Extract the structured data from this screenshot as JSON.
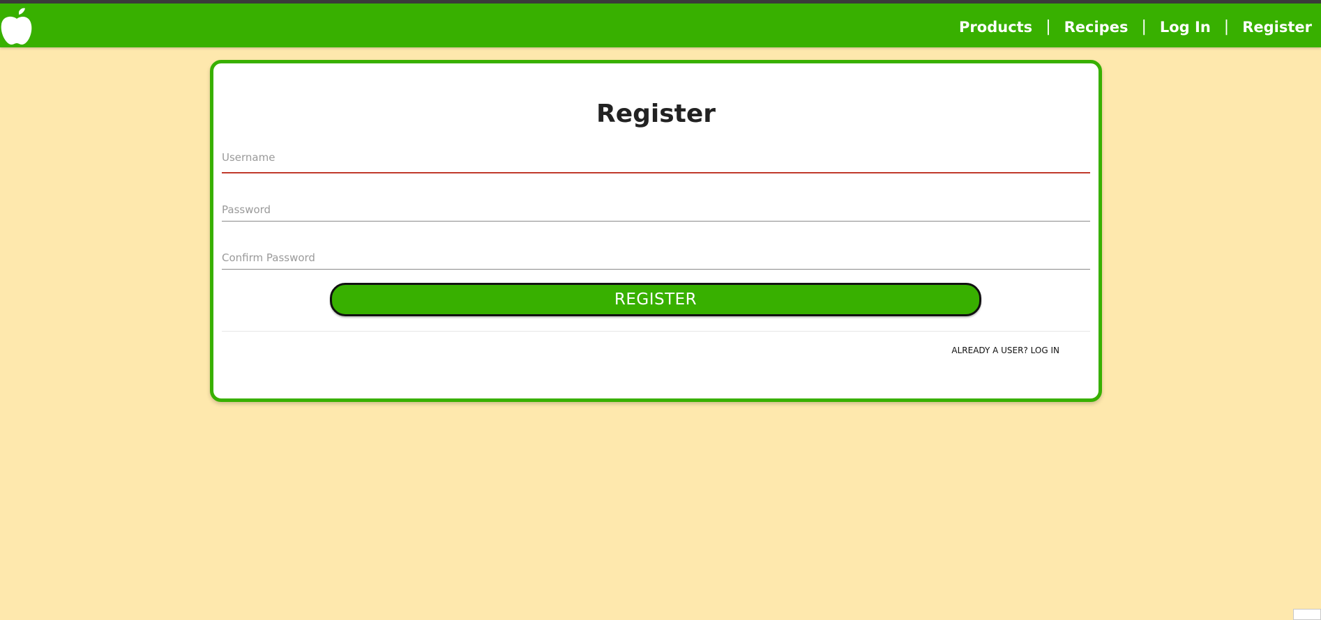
{
  "nav": {
    "logo_icon": "apple-icon",
    "links": [
      "Products",
      "Recipes",
      "Log In",
      "Register"
    ],
    "separator": "|"
  },
  "form": {
    "title": "Register",
    "fields": {
      "username": {
        "placeholder": "Username",
        "value": ""
      },
      "password": {
        "placeholder": "Password",
        "value": ""
      },
      "confirm_password": {
        "placeholder": "Confirm Password",
        "value": ""
      }
    },
    "submit_label": "REGISTER",
    "login_link": "ALREADY A USER? LOG IN"
  },
  "colors": {
    "brand_green": "#38b000",
    "background": "#fee8ad",
    "active_underline": "#c0392b"
  }
}
